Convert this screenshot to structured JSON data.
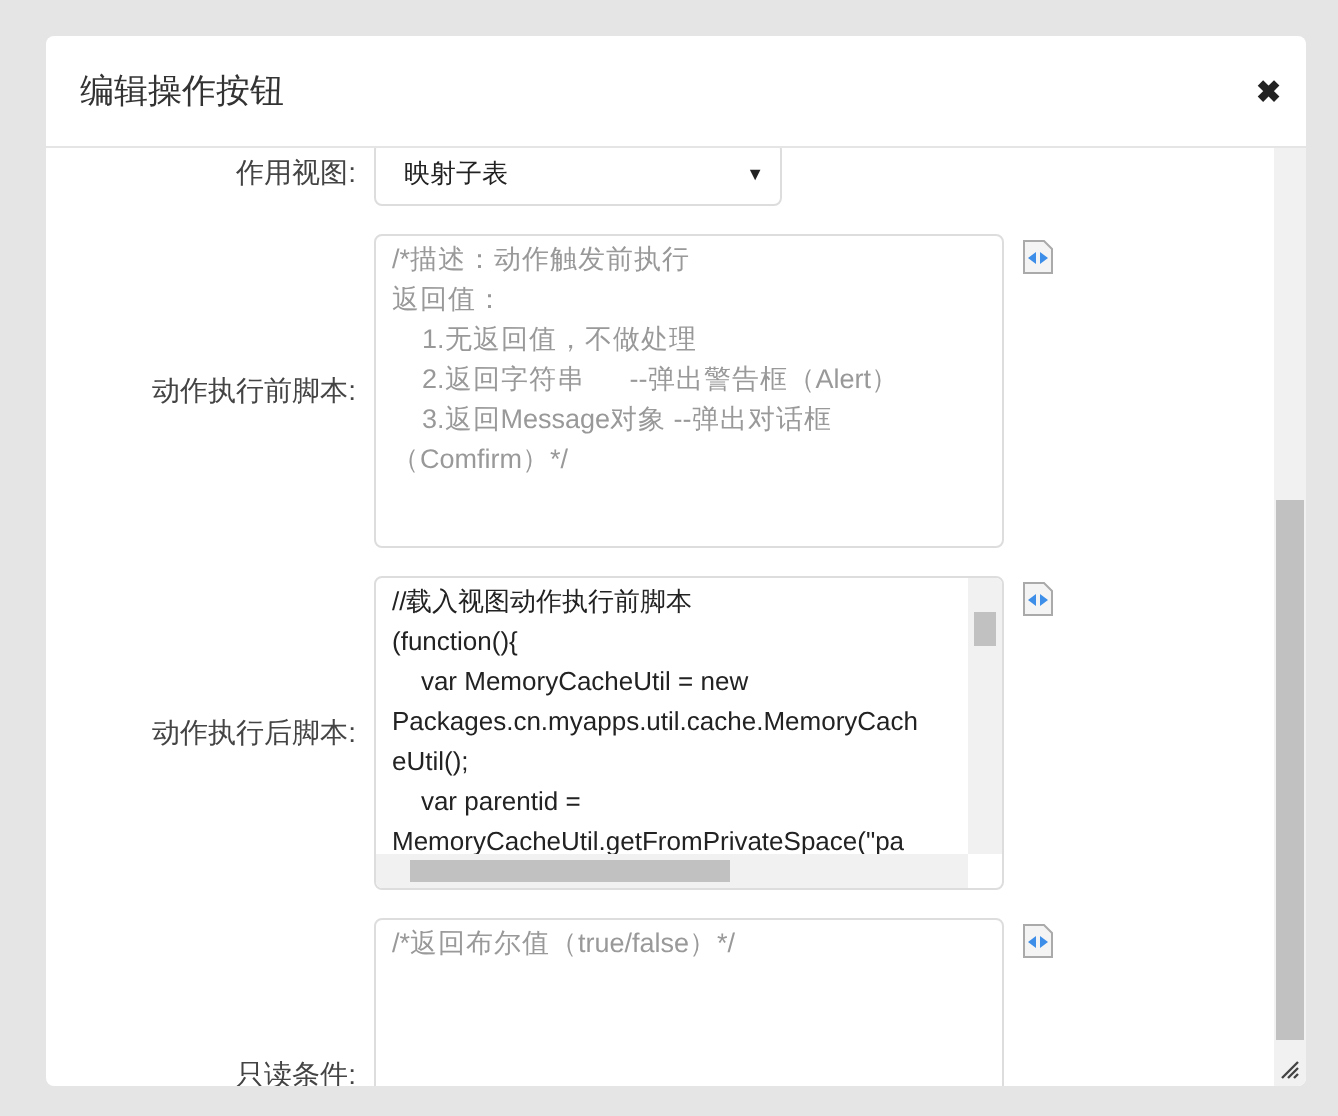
{
  "dialog": {
    "title": "编辑操作按钮",
    "close": "✖"
  },
  "fields": [
    {
      "kind": "select",
      "label": "作用视图:",
      "value": "映射子表",
      "arrow": "▼"
    },
    {
      "kind": "script",
      "label": "动作执行前脚本:",
      "placeholder": [
        "/*描述：动作触发前执行",
        "返回值：",
        "    1.无返回值，不做处理",
        "    2.返回字符串      --弹出警告框（Alert）",
        "    3.返回Message对象 --弹出对话框",
        "（Comfirm）*/"
      ]
    },
    {
      "kind": "script",
      "label": "动作执行后脚本:",
      "value": "//载入视图动作执行前脚本\n(function(){\n    var MemoryCacheUtil = new\nPackages.cn.myapps.util.cache.MemoryCach\neUtil();\n    var parentid =\nMemoryCacheUtil.getFromPrivateSpace(\"pa"
    },
    {
      "kind": "script",
      "label": "只读条件:",
      "placeholder": [
        "/*返回布尔值（true/false）*/"
      ]
    }
  ]
}
